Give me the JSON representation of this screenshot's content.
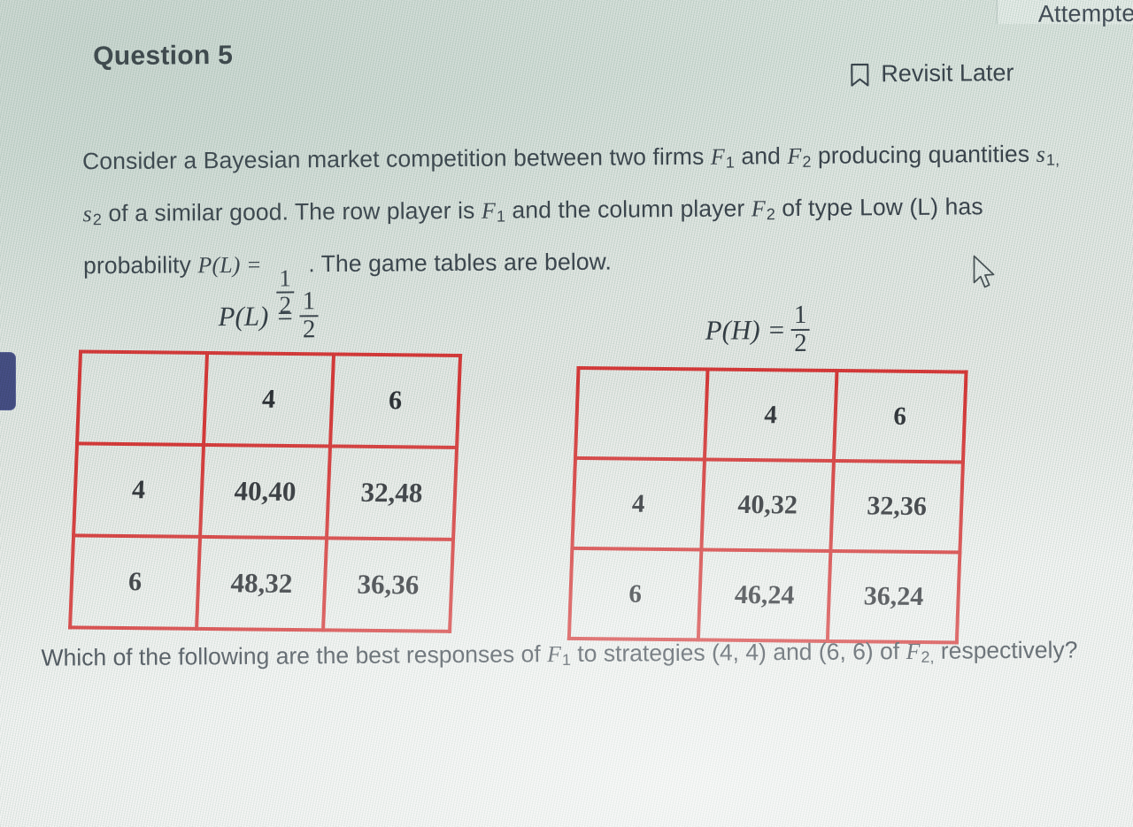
{
  "tab": {
    "label": "Attempte"
  },
  "header": {
    "question_title": "Question 5",
    "revisit_label": "Revisit Later",
    "bookmark_icon": "bookmark-icon"
  },
  "stem": {
    "p1": "Consider a Bayesian market competition between two firms",
    "firm1": "F",
    "firm1_sub": "1",
    "and": "and",
    "firm2": "F",
    "firm2_sub": "2",
    "p2": "producing quantities",
    "s1": "s",
    "s1_sub": "1,",
    "s2": "s",
    "s2_sub": "2",
    "p3": "of a similar good. The row player is",
    "p4": "and the column player",
    "p5": "of type Low (L) has probability",
    "prob_expr": "P(L) =",
    "frac_num": "1",
    "frac_den": "2",
    "p6": ". The game tables are below."
  },
  "tables": {
    "left": {
      "caption_prob": "P(L)",
      "caption_eq": "=",
      "caption_num": "1",
      "caption_den": "2",
      "corner": "",
      "col_headers": [
        "4",
        "6"
      ],
      "row_headers": [
        "4",
        "6"
      ],
      "cells": [
        [
          "40,40",
          "32,48"
        ],
        [
          "48,32",
          "36,36"
        ]
      ]
    },
    "right": {
      "caption_prob": "P(H)",
      "caption_eq": "=",
      "caption_num": "1",
      "caption_den": "2",
      "corner": "",
      "col_headers": [
        "4",
        "6"
      ],
      "row_headers": [
        "4",
        "6"
      ],
      "cells": [
        [
          "40,32",
          "32,36"
        ],
        [
          "46,24",
          "36,24"
        ]
      ]
    }
  },
  "tail": {
    "t1": "Which of the following are the best responses of",
    "f1": "F",
    "f1_sub": "1",
    "t2": "to strategies (4, 4) and (6, 6) of",
    "f2": "F",
    "f2_sub": "2,",
    "t3": "respectively?"
  },
  "colors": {
    "matrix_border": "#de3b3b",
    "text": "#3d464f",
    "screen_bg": "#e3e8e4",
    "edge_chip": "#474f86"
  },
  "decor": {
    "edge_chip_name": "left-edge-blue-chip",
    "cursor_name": "mouse-cursor"
  }
}
